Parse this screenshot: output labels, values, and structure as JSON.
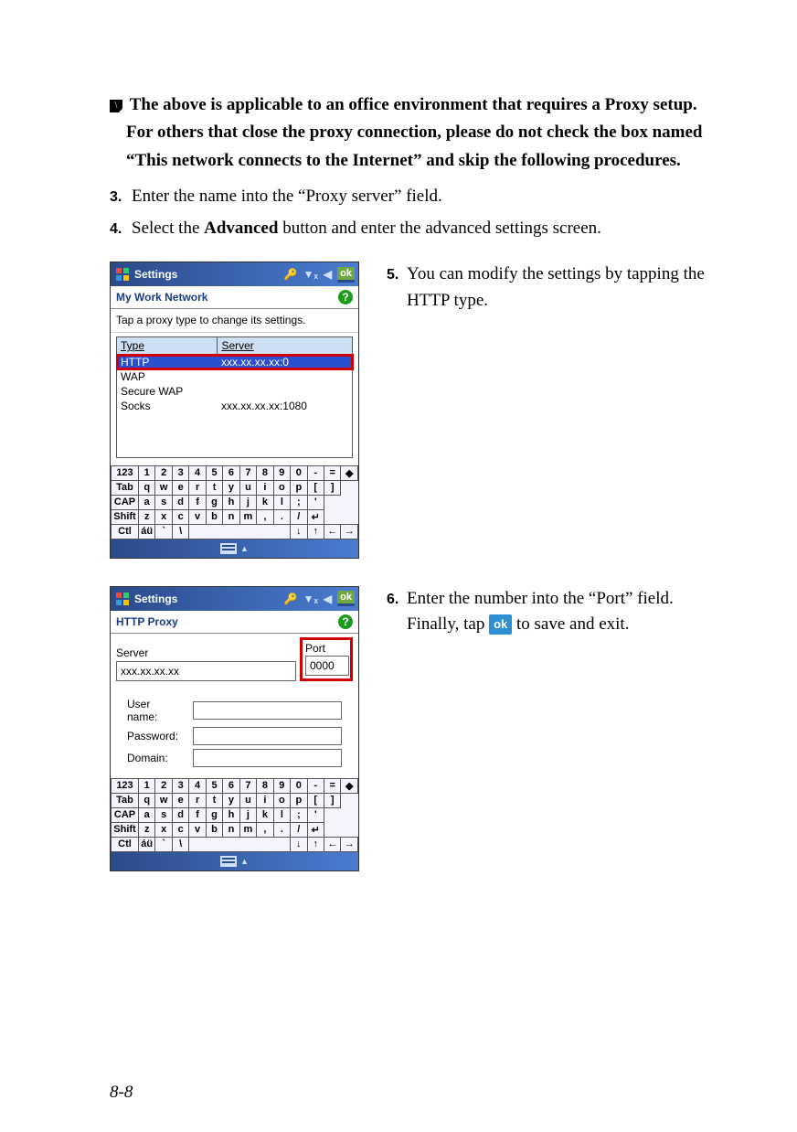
{
  "note": {
    "para1": "The above is applicable to an office environment that requires a Proxy setup.",
    "para2": "For others that close the proxy connection, please do not check the box named “This network connects to the Internet” and skip the following procedures."
  },
  "step3": {
    "num": "3.",
    "text": "Enter the name into the “Proxy server” field."
  },
  "step4": {
    "num": "4.",
    "text_before": "Select the ",
    "bold": "Advanced",
    "text_after": " button and enter the advanced settings screen."
  },
  "step5": {
    "num": "5.",
    "text": "You can modify the settings by tapping the HTTP type."
  },
  "step6": {
    "num": "6.",
    "text_before": "Enter the number into the “Port” field. Finally, tap ",
    "ok_label": "ok",
    "text_after": " to save and exit."
  },
  "pda1": {
    "title": "Settings",
    "ok": "ok",
    "subtitle": "My Work Network",
    "instruction": "Tap a proxy type to change its settings.",
    "columns": {
      "c1": "Type",
      "c2": "Server"
    },
    "rows": [
      {
        "type": "HTTP",
        "server": "xxx.xx.xx.xx:0",
        "selected": true
      },
      {
        "type": "WAP",
        "server": ""
      },
      {
        "type": "Secure WAP",
        "server": ""
      },
      {
        "type": "Socks",
        "server": "xxx.xx.xx.xx:1080"
      }
    ],
    "kbd": {
      "r1": [
        "123",
        "1",
        "2",
        "3",
        "4",
        "5",
        "6",
        "7",
        "8",
        "9",
        "0",
        "-",
        "=",
        "◆"
      ],
      "r2": [
        "Tab",
        "q",
        "w",
        "e",
        "r",
        "t",
        "y",
        "u",
        "i",
        "o",
        "p",
        "[",
        "]"
      ],
      "r3": [
        "CAP",
        "a",
        "s",
        "d",
        "f",
        "g",
        "h",
        "j",
        "k",
        "l",
        ";",
        "'"
      ],
      "r4": [
        "Shift",
        "z",
        "x",
        "c",
        "v",
        "b",
        "n",
        "m",
        ",",
        ".",
        "/",
        "↵"
      ],
      "r5": [
        "Ctl",
        "áü",
        "`",
        "\\",
        " ",
        "↓",
        "↑",
        "←",
        "→"
      ]
    }
  },
  "pda2": {
    "title": "Settings",
    "ok": "ok",
    "subtitle": "HTTP Proxy",
    "server_label": "Server",
    "server_value": "xxx.xx.xx.xx",
    "port_label": "Port",
    "port_value": "0000",
    "user_label": "User name:",
    "pass_label": "Password:",
    "domain_label": "Domain:",
    "kbd": {
      "r1": [
        "123",
        "1",
        "2",
        "3",
        "4",
        "5",
        "6",
        "7",
        "8",
        "9",
        "0",
        "-",
        "=",
        "◆"
      ],
      "r2": [
        "Tab",
        "q",
        "w",
        "e",
        "r",
        "t",
        "y",
        "u",
        "i",
        "o",
        "p",
        "[",
        "]"
      ],
      "r3": [
        "CAP",
        "a",
        "s",
        "d",
        "f",
        "g",
        "h",
        "j",
        "k",
        "l",
        ";",
        "'"
      ],
      "r4": [
        "Shift",
        "z",
        "x",
        "c",
        "v",
        "b",
        "n",
        "m",
        ",",
        ".",
        "/",
        "↵"
      ],
      "r5": [
        "Ctl",
        "áü",
        "`",
        "\\",
        " ",
        "↓",
        "↑",
        "←",
        "→"
      ]
    }
  },
  "page_number": "8-8"
}
